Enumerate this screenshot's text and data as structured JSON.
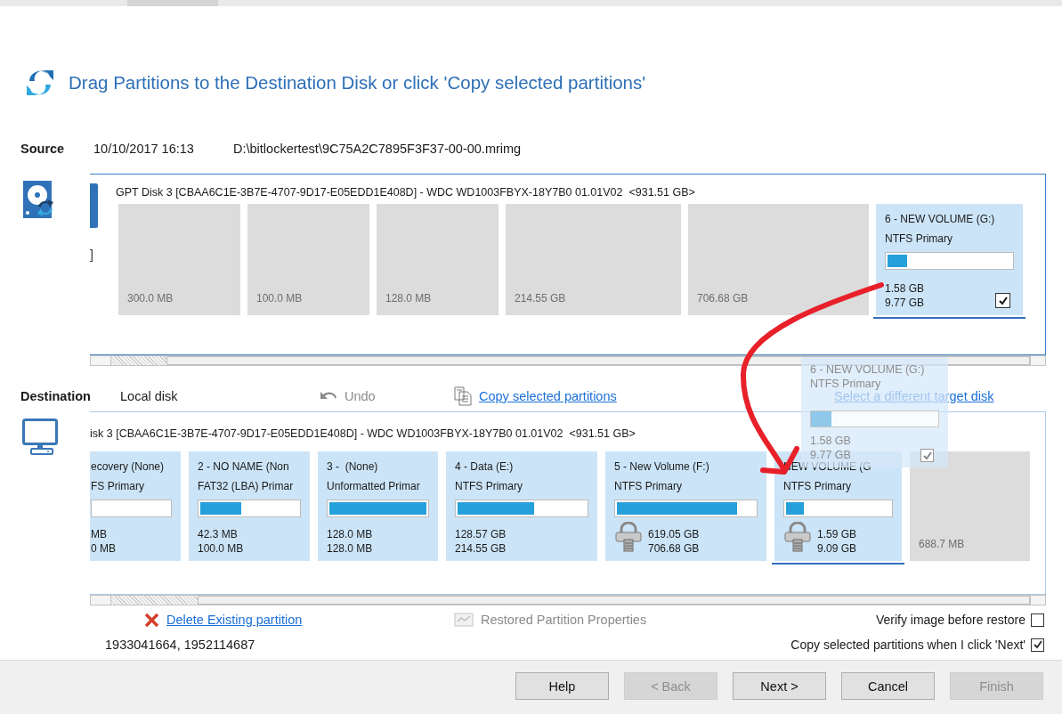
{
  "header": {
    "title": "Drag Partitions to the Destination Disk or click 'Copy selected partitions'"
  },
  "source": {
    "label": "Source",
    "date": "10/10/2017 16:13",
    "path": "D:\\bitlockertest\\9C75A2C7895F3F37-00-00.mrimg",
    "cut_label": "]",
    "disk": "GPT Disk 3 [CBAA6C1E-3B7E-4707-9D17-E05EDD1E408D] - WDC WD1003FBYX-18Y7B0 01.01V02  <931.51 GB>",
    "partitions": [
      {
        "kind": "empty",
        "size": "300.0 MB",
        "selected": false
      },
      {
        "kind": "empty",
        "size": "100.0 MB",
        "selected": false
      },
      {
        "kind": "empty",
        "size": "128.0 MB",
        "selected": false
      },
      {
        "kind": "empty",
        "size": "214.55 GB",
        "selected": false
      },
      {
        "kind": "empty",
        "size": "706.68 GB",
        "selected": false
      },
      {
        "kind": "volume",
        "name": "6 - NEW VOLUME (G:)",
        "fs": "NTFS Primary",
        "level": 0.16,
        "used": "1.58 GB",
        "total": "9.77 GB",
        "encrypted": false,
        "checked": true,
        "selected": true
      }
    ]
  },
  "destination": {
    "label": "Destination",
    "target": "Local disk",
    "undo": {
      "label": "Undo",
      "disabled": true
    },
    "copy_link": "Copy selected partitions",
    "select_link": "Select a different target disk",
    "disk": "isk 3 [CBAA6C1E-3B7E-4707-9D17-E05EDD1E408D] - WDC WD1003FBYX-18Y7B0 01.01V02  <931.51 GB>",
    "partitions": [
      {
        "kind": "volume",
        "name": "ecovery (None)",
        "fs": "FS Primary",
        "level": 0,
        "used": "MB",
        "total": "0 MB",
        "encrypted": false,
        "selected": false
      },
      {
        "kind": "volume",
        "name": "2 - NO NAME (Non",
        "fs": "FAT32 (LBA) Primar",
        "level": 0.42,
        "used": "42.3 MB",
        "total": "100.0 MB",
        "encrypted": false,
        "selected": false
      },
      {
        "kind": "volume",
        "name": "3 -  (None)",
        "fs": "Unformatted Primar",
        "level": 1,
        "used": "128.0 MB",
        "total": "128.0 MB",
        "encrypted": false,
        "selected": false
      },
      {
        "kind": "volume",
        "name": "4 - Data (E:)",
        "fs": "NTFS Primary",
        "level": 0.6,
        "used": "128.57 GB",
        "total": "214.55 GB",
        "encrypted": false,
        "selected": false
      },
      {
        "kind": "volume",
        "name": "5 - New Volume (F:)",
        "fs": "NTFS Primary",
        "level": 0.87,
        "used": "619.05 GB",
        "total": "706.68 GB",
        "encrypted": true,
        "selected": false
      },
      {
        "kind": "volume",
        "name": "NEW VOLUME (G",
        "fs": "NTFS Primary",
        "level": 0.17,
        "used": "1.59 GB",
        "total": "9.09 GB",
        "encrypted": true,
        "selected": true
      },
      {
        "kind": "empty",
        "size": "688.7 MB",
        "selected": false
      }
    ]
  },
  "drag_ghost": {
    "name": "6 - NEW VOLUME (G:)",
    "fs": "NTFS Primary",
    "level": 0.16,
    "used": "1.58 GB",
    "total": "9.77 GB",
    "checked": true
  },
  "bottom": {
    "delete_link": "Delete Existing partition",
    "properties": {
      "label": "Restored Partition Properties",
      "disabled": true
    },
    "sectors": "1933041664, 1952114687",
    "options": [
      {
        "label": "Verify image before restore",
        "checked": false
      },
      {
        "label": "Copy selected partitions when I click 'Next'",
        "checked": true
      }
    ]
  },
  "buttons": [
    {
      "label": "Help",
      "disabled": false
    },
    {
      "label": "< Back",
      "disabled": true
    },
    {
      "label": "Next >",
      "disabled": false
    },
    {
      "label": "Cancel",
      "disabled": false
    },
    {
      "label": "Finish",
      "disabled": true
    }
  ]
}
